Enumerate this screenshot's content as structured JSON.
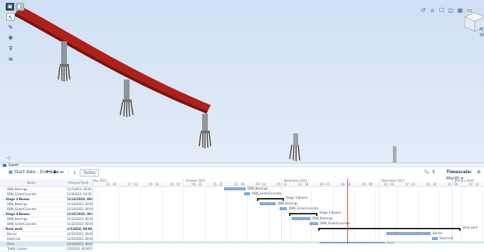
{
  "viewport": {
    "left_toolbar": [
      "cursor-icon",
      "pencil-icon",
      "pan-icon",
      "filter-icon",
      "layers-icon"
    ],
    "top_right_toolbar": [
      "undo-icon",
      "home-icon",
      "box-icon",
      "section-icon",
      "grid-icon",
      "window-icon"
    ],
    "scale_label": [
      "N",
      "W"
    ]
  },
  "panel": {
    "tab_label": "Gantt"
  },
  "toolbar": {
    "date_range": "Start date - End date",
    "today_label": "Today",
    "timescale_label": "Timescale:",
    "timescale_value": "Month"
  },
  "table": {
    "headers": {
      "name": "Name",
      "planned_finish": "Planned finish"
    },
    "rows": [
      {
        "name": "DBN_Bearings",
        "date": "11/7/2023, 00:00 PM",
        "type": "task"
      },
      {
        "name": "DBN_GirderConcrete",
        "date": "11/9/2023, 00:00 PM",
        "type": "task"
      },
      {
        "name": "Stage 3 Beams",
        "date": "11/14/2023, 00:00 PM",
        "type": "group"
      },
      {
        "name": "DBN_Bearings",
        "date": "11/14/2023, 00:00 PM",
        "type": "task"
      },
      {
        "name": "DBN_GirderConcrete",
        "date": "11/14/2023, 00:00 PM",
        "type": "task"
      },
      {
        "name": "Stage 4 Beams",
        "date": "11/22/2023, 00:00 PM",
        "type": "group"
      },
      {
        "name": "DBN_Bearings",
        "date": "11/22/2023, 00:00 PM",
        "type": "task"
      },
      {
        "name": "DBN_GirderConcrete",
        "date": "11/22/2023, 00:00 PM",
        "type": "task"
      },
      {
        "name": "Deck work",
        "date": "1/5/2024, 00:00 PM",
        "type": "group"
      },
      {
        "name": "Barrier",
        "date": "12/20/2023, 00:00 PM",
        "type": "task"
      },
      {
        "name": "Electrical",
        "date": "12/23/2023, 00:00 PM",
        "type": "task"
      },
      {
        "name": "Deck",
        "date": "12/14/2023, 00:00 PM",
        "type": "task",
        "selected": true
      },
      {
        "name": "Traffic Control",
        "date": "1/5/2024, 00:00 PM",
        "type": "task"
      }
    ]
  },
  "timeline": {
    "months": [
      "Sep 2023",
      "October 2023",
      "November 2023",
      "December 2023",
      "January 2024"
    ],
    "weeks": [
      "10 - 16",
      "17 - 23",
      "24 - 30",
      "01 - 07",
      "08 - 14",
      "15 - 21",
      "22 - 28",
      "29 - 04",
      "05 - 11",
      "12 - 18",
      "19 - 25",
      "26 - 02",
      "03 - 09",
      "10 - 16",
      "17 - 23",
      "24 - 30",
      "31 - 06",
      "07 - 13",
      "14 - 20"
    ],
    "bar_labels": [
      "DBN_Bearings",
      "DBN_GirderConcrete",
      "Stage 3 Beams",
      "DBN_Bearings",
      "DBN_GirderConcrete",
      "Stage 4 Beams",
      "DBN_Bearings",
      "DBN_GirderConcrete",
      "Deck work",
      "Barrier",
      "Electrical",
      "Deck",
      "Traffic Control"
    ]
  }
}
